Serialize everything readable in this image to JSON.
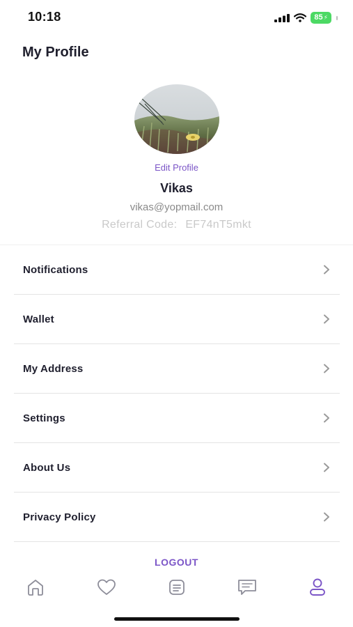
{
  "status_bar": {
    "time": "10:18",
    "battery": "85"
  },
  "header": {
    "title": "My Profile"
  },
  "profile": {
    "edit_label": "Edit Profile",
    "name": "Vikas",
    "email": "vikas@yopmail.com",
    "referral_label": "Referral Code:",
    "referral_code": "EF74nT5mkt"
  },
  "menu": {
    "items": [
      {
        "label": "Notifications"
      },
      {
        "label": "Wallet"
      },
      {
        "label": "My Address"
      },
      {
        "label": "Settings"
      },
      {
        "label": "About Us"
      },
      {
        "label": "Privacy Policy"
      }
    ]
  },
  "logout_label": "LOGOUT",
  "tabs": [
    {
      "icon": "home-icon"
    },
    {
      "icon": "heart-icon"
    },
    {
      "icon": "list-icon"
    },
    {
      "icon": "chat-icon"
    },
    {
      "icon": "profile-icon",
      "active": true
    }
  ],
  "colors": {
    "accent": "#7b55c7",
    "inactive_icon": "#8d8d99",
    "battery": "#4cd964"
  }
}
